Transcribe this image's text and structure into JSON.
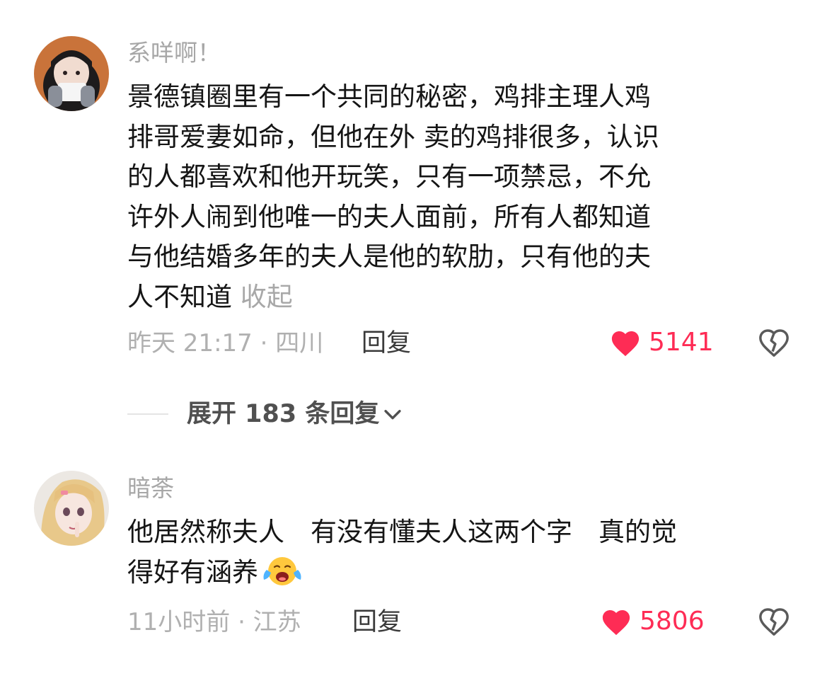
{
  "comments": [
    {
      "username": "系咩啊！",
      "lines": [
        "景德镇圈里有一个共同的秘密，鸡排主理人鸡",
        "排哥爱妻如命，但他在外 卖的鸡排很多，认识",
        "的人都喜欢和他开玩笑，只有一项禁忌，不允",
        "许外人闹到他唯一的夫人面前，所有人都知道",
        "与他结婚多年的夫人是他的软肋，只有他的夫",
        "人不知道"
      ],
      "collapse_label": "收起",
      "meta": "昨天 21:17 · 四川",
      "reply_label": "回复",
      "likes": "5141",
      "like_icon": "heart-filled-icon",
      "dislike_icon": "broken-heart-icon"
    },
    {
      "username": "暗荼",
      "lines": [
        "他居然称夫人　有没有懂夫人这两个字　真的觉",
        "得好有涵养"
      ],
      "emoji": "crying-face-emoji",
      "meta": "11小时前 · 江苏",
      "reply_label": "回复",
      "likes": "5806",
      "like_icon": "heart-filled-icon",
      "dislike_icon": "broken-heart-icon"
    }
  ],
  "expand_replies": {
    "label": "展开 183 条回复",
    "icon": "chevron-down-icon"
  },
  "colors": {
    "accent": "#fe2c55",
    "username": "#a7a7a7",
    "meta": "#b0b0b0",
    "text": "#151515"
  }
}
